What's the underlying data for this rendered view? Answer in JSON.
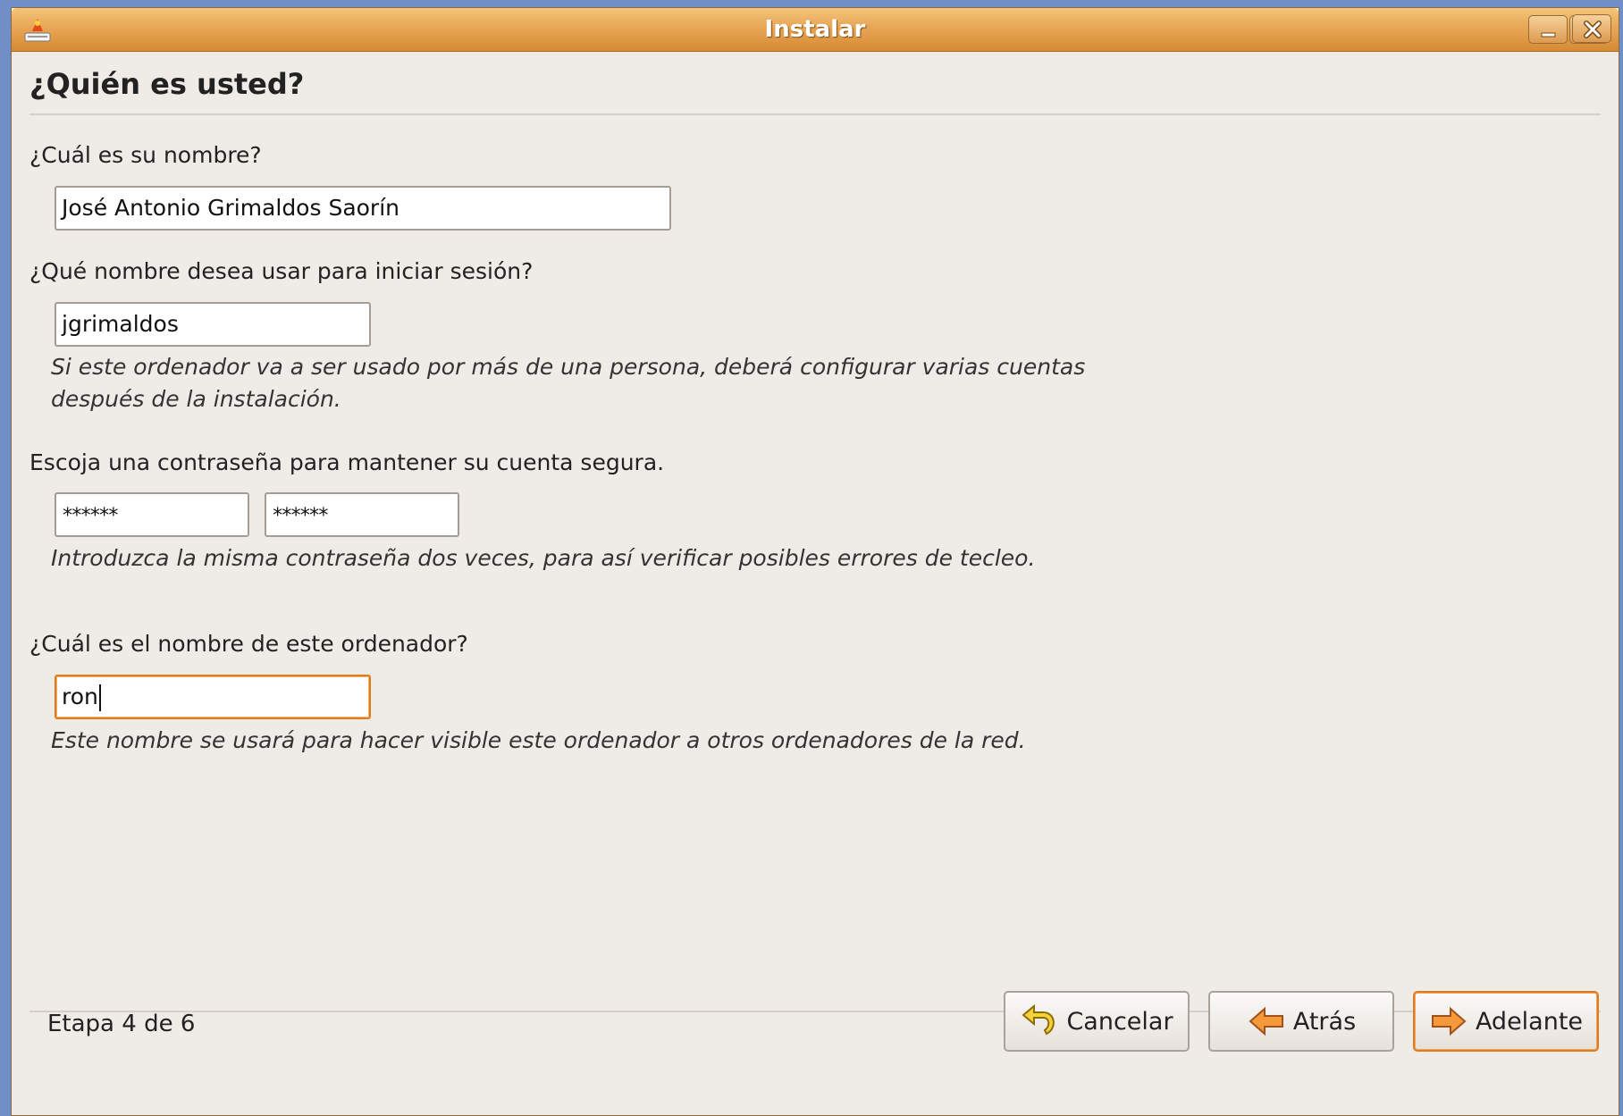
{
  "window": {
    "title": "Instalar",
    "icon": "installer-icon",
    "controls": [
      "minimize-icon",
      "maximize-icon",
      "close-icon"
    ]
  },
  "page": {
    "title": "¿Quién es usted?"
  },
  "name_section": {
    "label": "¿Cuál es su nombre?",
    "value": "José Antonio Grimaldos Saorín"
  },
  "login_section": {
    "label": "¿Qué nombre desea usar para iniciar sesión?",
    "value": "jgrimaldos",
    "help_line1": "Si este ordenador va a ser usado por más de una persona, deberá configurar varias cuentas",
    "help_line2": "después de la instalación."
  },
  "password_section": {
    "label": "Escoja una contraseña para mantener su cuenta segura.",
    "password_mask": "******",
    "confirm_mask": "******",
    "help": "Introduzca la misma contraseña dos veces, para así verificar posibles errores de tecleo."
  },
  "hostname_section": {
    "label": "¿Cuál es el nombre de este ordenador?",
    "value": "ron",
    "help": "Este nombre se usará para hacer visible este ordenador a otros ordenadores de la red."
  },
  "footer": {
    "stage": "Etapa 4 de 6",
    "cancel_label": "Cancelar",
    "back_label": "Atrás",
    "forward_label": "Adelante"
  },
  "colors": {
    "titlebar": "#e8a656",
    "focus": "#e07c1e",
    "background": "#efebe7"
  }
}
